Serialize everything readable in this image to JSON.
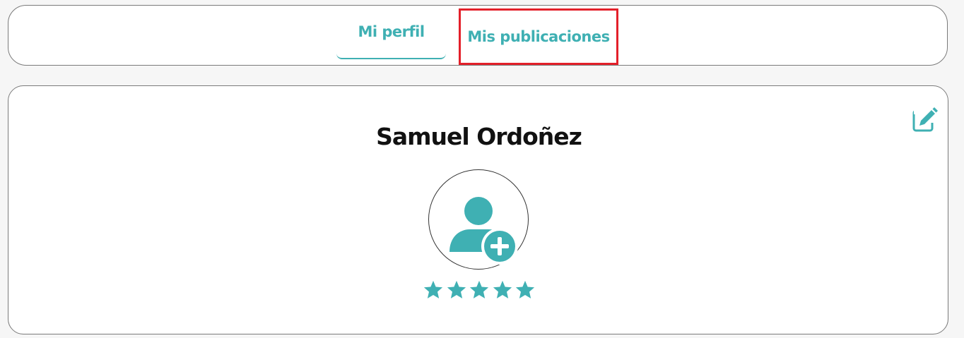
{
  "tabs": [
    {
      "label": "Mi perfil",
      "active": true
    },
    {
      "label": "Mis publicaciones",
      "active": false,
      "highlighted": true
    }
  ],
  "profile": {
    "name": "Samuel Ordoñez",
    "avatar_icon": "user-plus-icon",
    "edit_icon": "edit-icon",
    "rating": {
      "value": 5,
      "max": 5
    }
  },
  "colors": {
    "accent": "#3fb0b3",
    "highlight_box": "#e3202a",
    "text": "#111111",
    "background": "#f6f6f6"
  }
}
